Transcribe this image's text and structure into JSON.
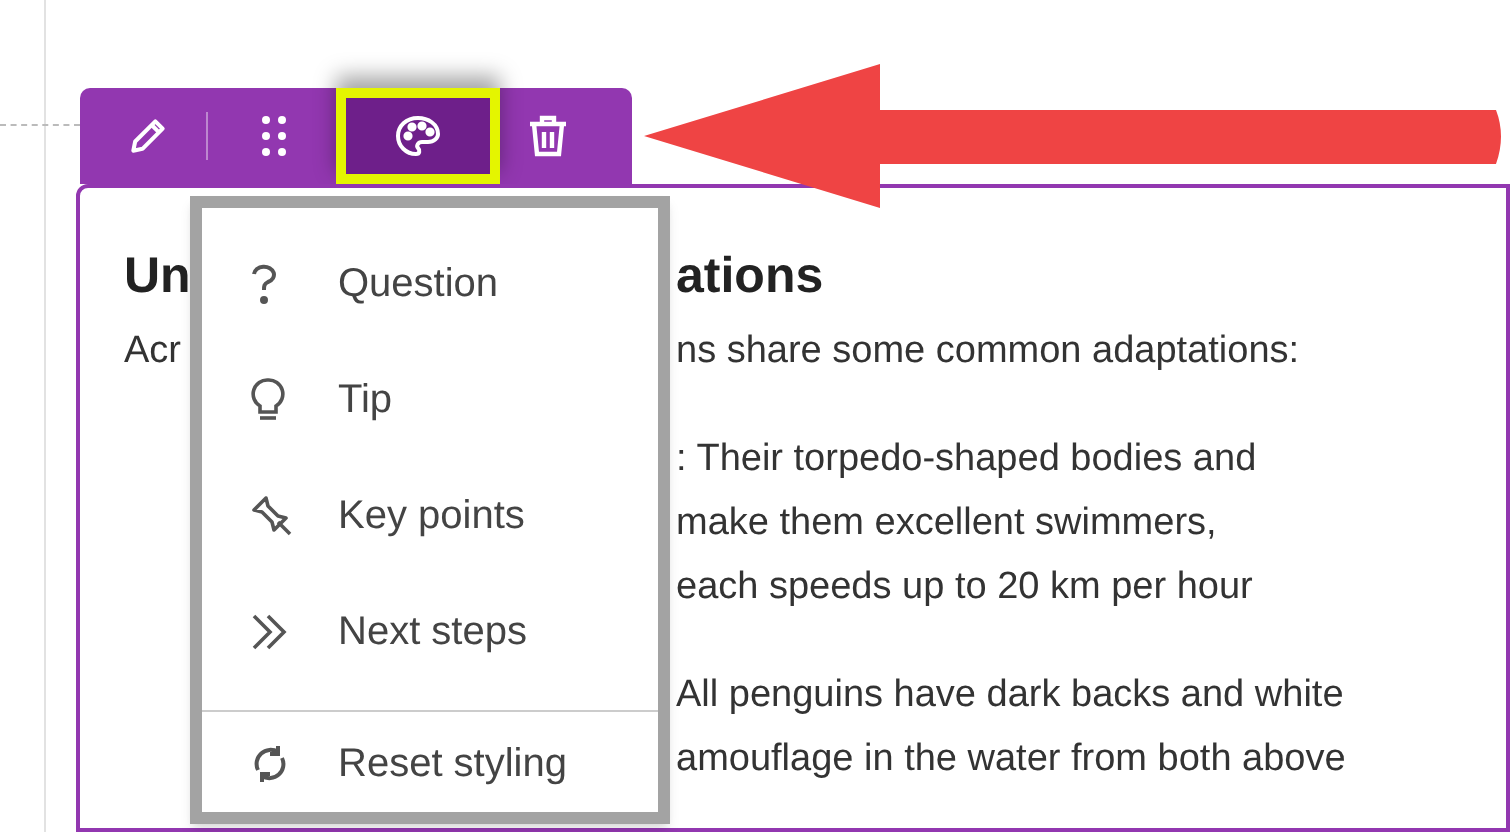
{
  "toolbar": {
    "buttons": [
      {
        "kind": "edit",
        "selected": false
      },
      {
        "kind": "drag",
        "selected": false
      },
      {
        "kind": "style",
        "selected": true
      },
      {
        "kind": "delete",
        "selected": false
      }
    ]
  },
  "card": {
    "lines": [
      {
        "kind": "heading",
        "left": "Un",
        "right": "ations"
      },
      {
        "kind": "text",
        "left": "Acr",
        "right": "ns share some common adaptations:"
      },
      {
        "kind": "text",
        "right": ": Their torpedo-shaped bodies and",
        "gap": true
      },
      {
        "kind": "text",
        "right": "make them excellent swimmers,"
      },
      {
        "kind": "text",
        "right": "each speeds up to 20 km per hour"
      },
      {
        "kind": "text",
        "right": "All penguins have dark backs and white",
        "gap": true
      },
      {
        "kind": "text",
        "right": "amouflage in the water from both above"
      }
    ]
  },
  "menu": {
    "items": [
      {
        "kind": "question",
        "label": "Question"
      },
      {
        "kind": "tip",
        "label": "Tip"
      },
      {
        "kind": "keypoints",
        "label": "Key points"
      },
      {
        "kind": "next",
        "label": "Next steps"
      }
    ],
    "footer": {
      "kind": "reset",
      "label": "Reset styling"
    }
  }
}
